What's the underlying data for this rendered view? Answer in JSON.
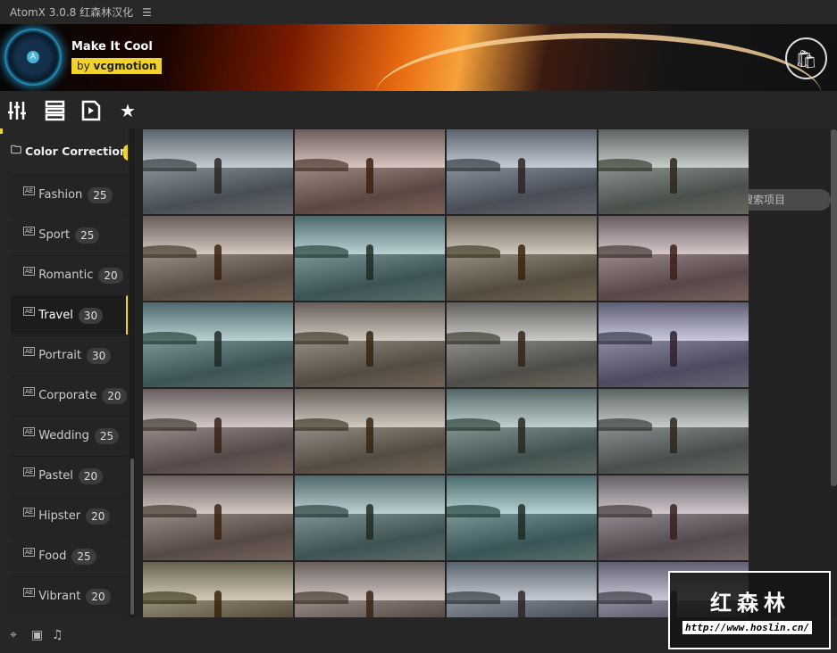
{
  "titlebar": {
    "title": "AtomX 3.0.8 红森林汉化",
    "menu_icon": "hamburger-icon"
  },
  "banner": {
    "pack_title": "Make It Cool",
    "author_prefix": "by",
    "author": "vcgmotion",
    "logo_letter": "A"
  },
  "toolbar": {
    "icons": [
      "sliders-icon",
      "list-icon",
      "video-file-icon",
      "star-icon"
    ],
    "search_placeholder": "搜索项目"
  },
  "sidebar": {
    "category": "Color Correction",
    "items": [
      {
        "label": "Fashion",
        "count": "25"
      },
      {
        "label": "Sport",
        "count": "25"
      },
      {
        "label": "Romantic",
        "count": "20"
      },
      {
        "label": "Travel",
        "count": "30",
        "selected": true
      },
      {
        "label": "Portrait",
        "count": "30"
      },
      {
        "label": "Corporate",
        "count": "20"
      },
      {
        "label": "Wedding",
        "count": "25"
      },
      {
        "label": "Pastel",
        "count": "20"
      },
      {
        "label": "Hipster",
        "count": "20"
      },
      {
        "label": "Food",
        "count": "25"
      },
      {
        "label": "Vibrant",
        "count": "20"
      }
    ],
    "item_icon_label": "AE"
  },
  "grid": {
    "tints": [
      "#9aa6b0",
      "#c09080",
      "#a0a8b8",
      "#a8b0a0",
      "#c8a890",
      "#70a0a0",
      "#c8b090",
      "#c09898",
      "#6a9a9a",
      "#c0a890",
      "#b0a898",
      "#9088b0",
      "#b09088",
      "#c0a890",
      "#80a098",
      "#98a098",
      "#b09080",
      "#80a8a8",
      "#70a8a8",
      "#a08890",
      "#d8c090",
      "#c0a090",
      "#a8b0c0",
      "#a898b8"
    ]
  },
  "accent": "#f2d22c",
  "bottombar": {
    "icons": [
      "target-icon",
      "play-box-icon",
      "music-icon"
    ]
  },
  "watermark": {
    "text": "红森林",
    "url": "http://www.hoslin.cn/"
  }
}
